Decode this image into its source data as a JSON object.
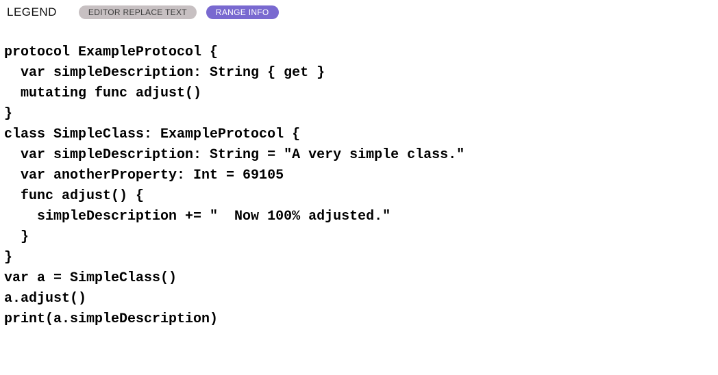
{
  "legend": {
    "title": "LEGEND",
    "pills": {
      "editor_replace": "EDITOR REPLACE TEXT",
      "range_info": "RANGE INFO"
    }
  },
  "code": {
    "lines": [
      "protocol ExampleProtocol {",
      "  var simpleDescription: String { get }",
      "  mutating func adjust()",
      "}",
      "",
      "class SimpleClass: ExampleProtocol {",
      "  var simpleDescription: String = \"A very simple class.\"",
      "  var anotherProperty: Int = 69105",
      "  func adjust() {",
      "    simpleDescription += \"  Now 100% adjusted.\"",
      "  }",
      "}",
      "var a = SimpleClass()",
      "a.adjust()",
      "print(a.simpleDescription)"
    ]
  }
}
